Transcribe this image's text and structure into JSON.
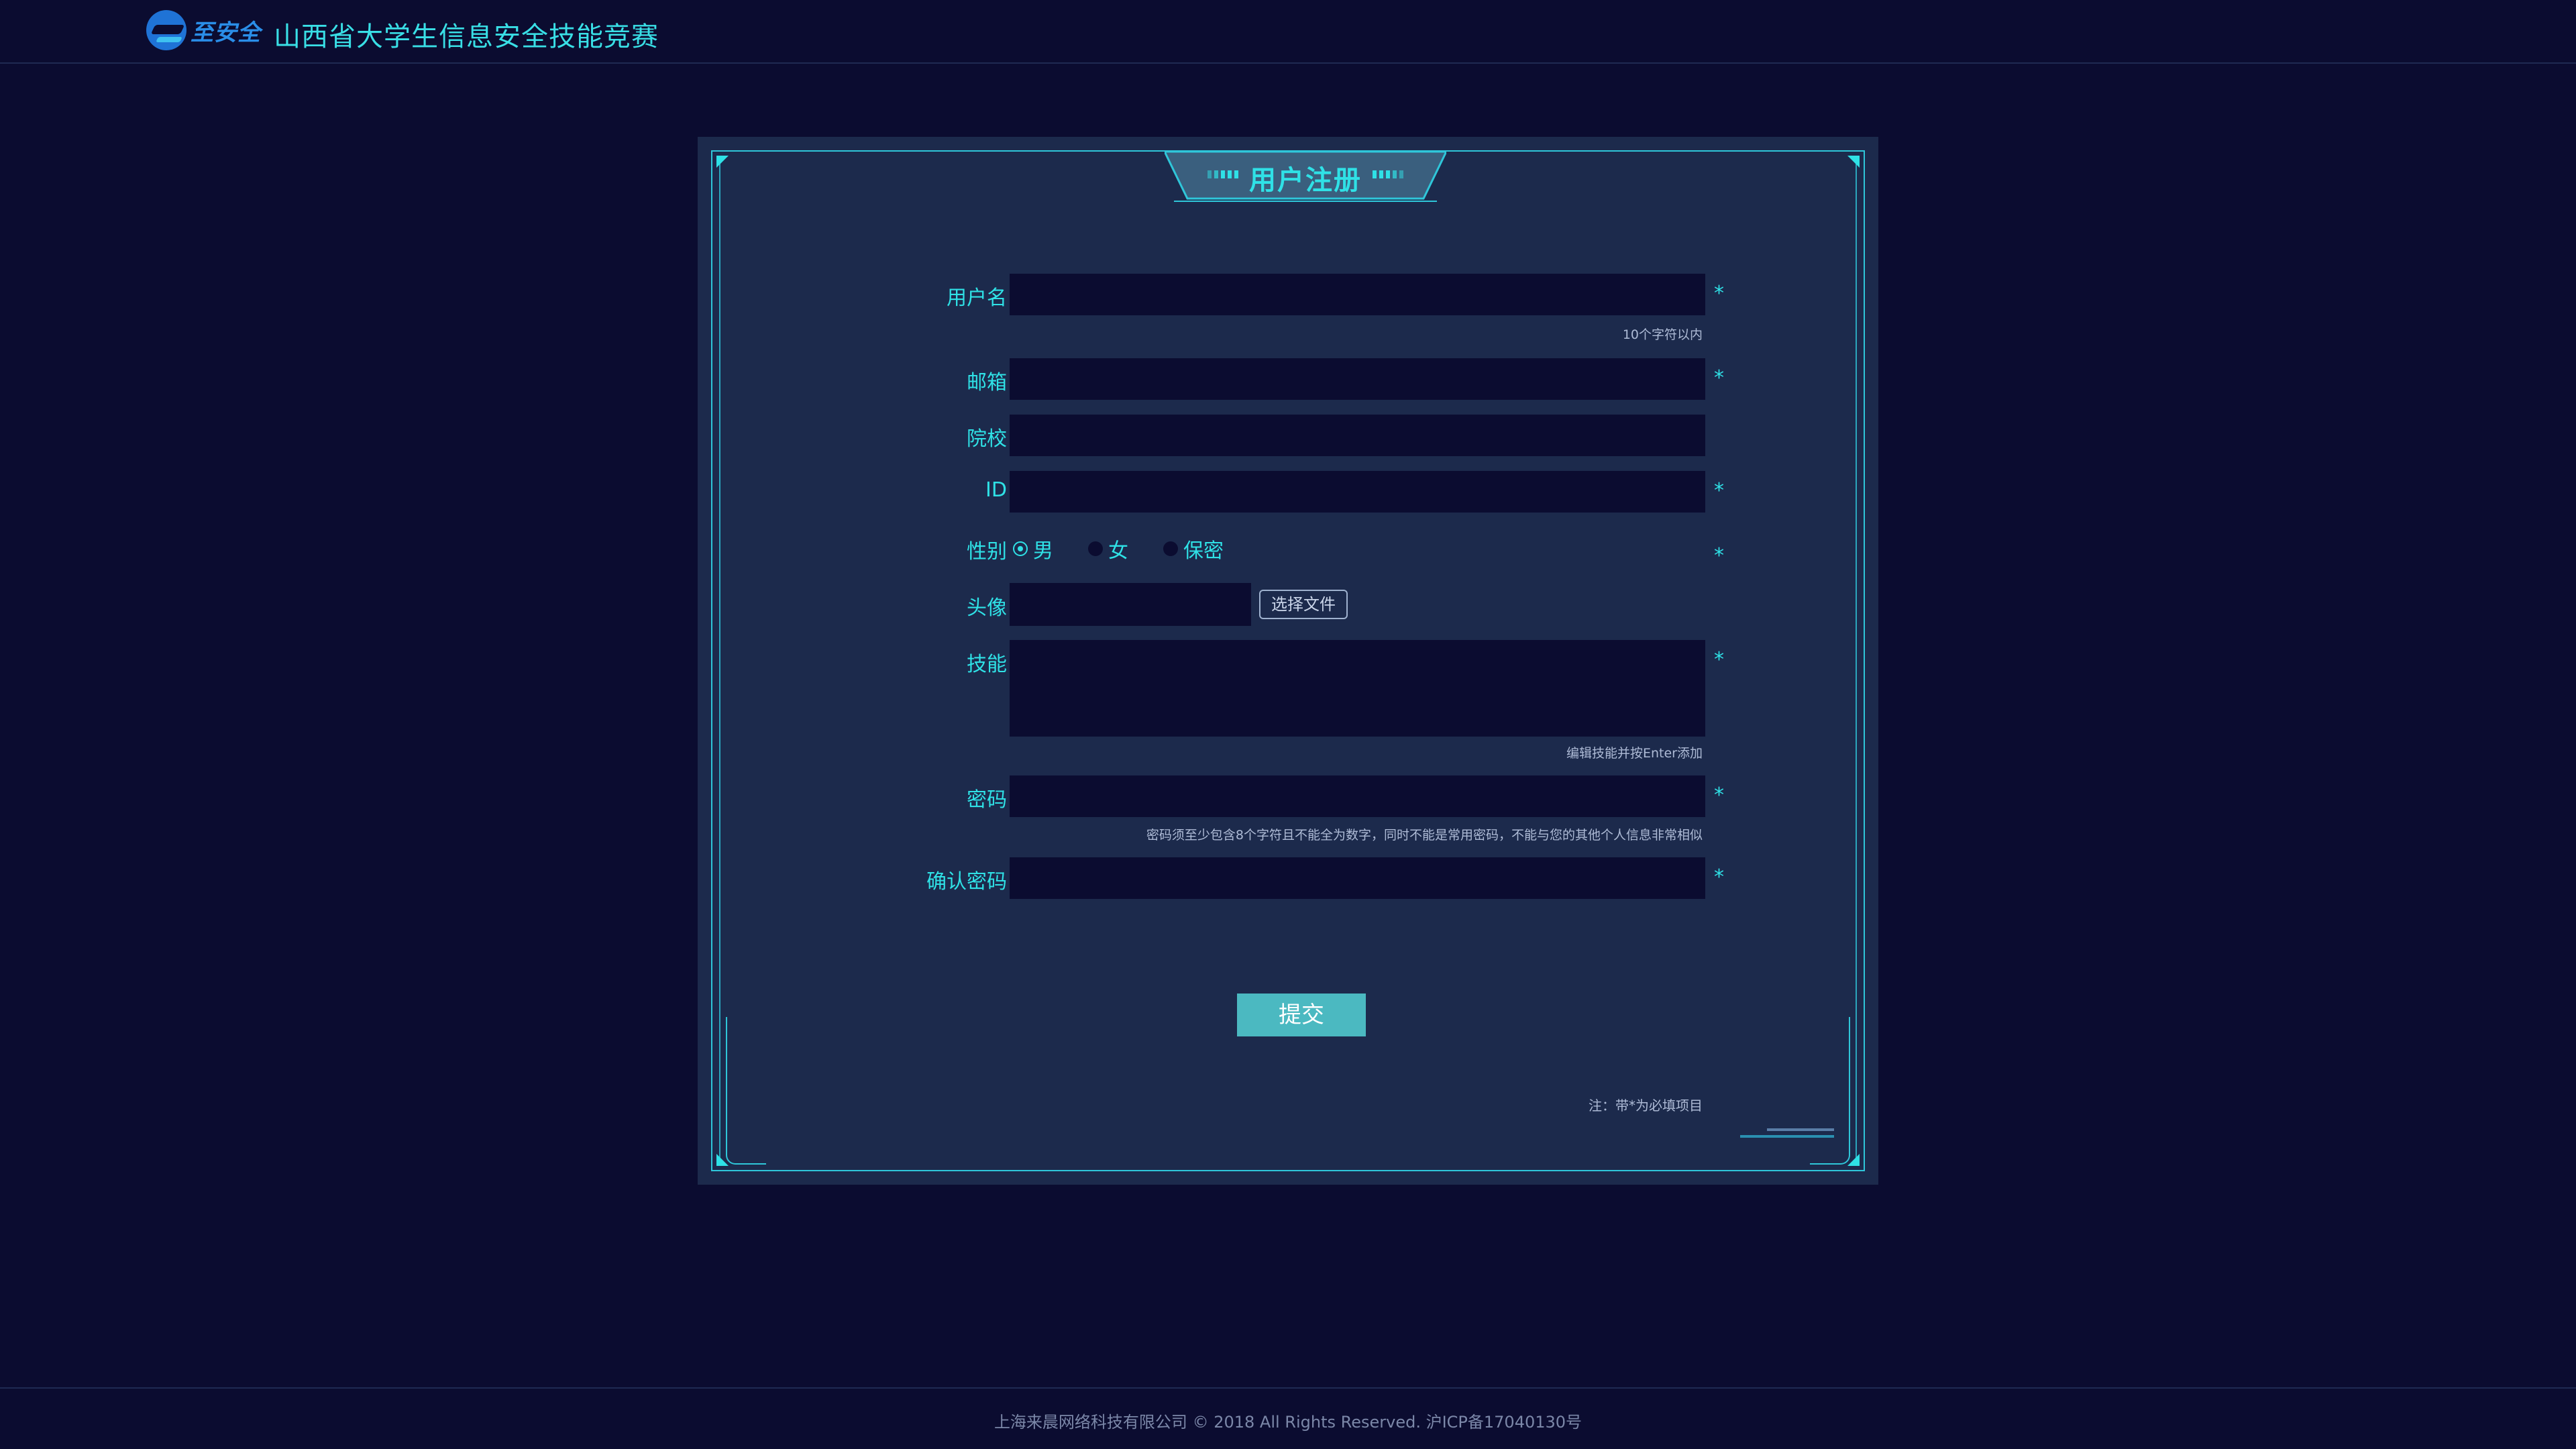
{
  "header": {
    "logo_text": "至安全",
    "site_title": "山西省大学生信息安全技能竞赛"
  },
  "panel": {
    "title": "用户注册"
  },
  "form": {
    "username": {
      "label": "用户名",
      "value": "",
      "placeholder": "",
      "required_mark": "*",
      "hint": "10个字符以内"
    },
    "email": {
      "label": "邮箱",
      "value": "",
      "placeholder": "",
      "required_mark": "*"
    },
    "school": {
      "label": "院校",
      "value": "",
      "placeholder": ""
    },
    "id": {
      "label": "ID",
      "value": "",
      "placeholder": "",
      "required_mark": "*"
    },
    "gender": {
      "label": "性别",
      "required_mark": "*",
      "options": [
        "男",
        "女",
        "保密"
      ],
      "selected": "男"
    },
    "avatar": {
      "label": "头像",
      "button_label": "选择文件"
    },
    "skills": {
      "label": "技能",
      "value": "",
      "required_mark": "*",
      "hint": "编辑技能并按Enter添加"
    },
    "password": {
      "label": "密码",
      "value": "",
      "required_mark": "*",
      "hint": "密码须至少包含8个字符且不能全为数字，同时不能是常用密码，不能与您的其他个人信息非常相似"
    },
    "confirm_password": {
      "label": "确认密码",
      "value": "",
      "required_mark": "*"
    },
    "submit_label": "提交",
    "note": "注：带*为必填项目"
  },
  "footer": {
    "text": "上海来晨网络科技有限公司 © 2018 All Rights Reserved.   沪ICP备17040130号"
  },
  "colors": {
    "background": "#0b0c30",
    "panel": "#1c2a4c",
    "accent": "#2fe1e6",
    "submit": "#4bb9c1"
  }
}
